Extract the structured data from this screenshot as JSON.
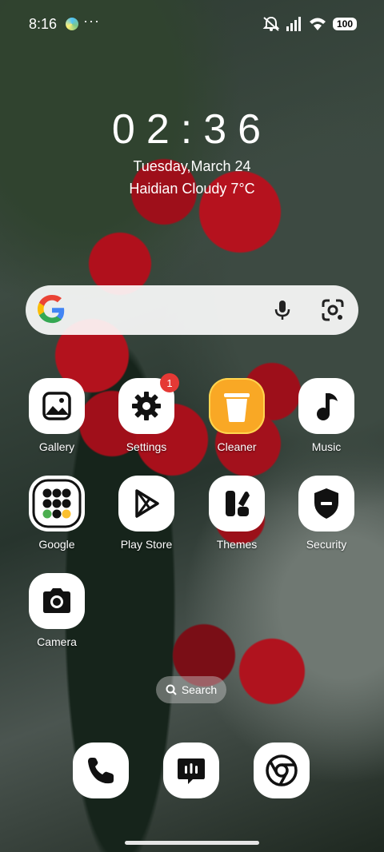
{
  "status_bar": {
    "time": "8:16",
    "more": "···",
    "battery": "100",
    "icons": [
      "app-notification-icon",
      "mute-icon",
      "signal-icon",
      "wifi-icon",
      "battery-icon"
    ]
  },
  "clock": {
    "time": "02:36",
    "date": "Tuesday,March 24",
    "weather": "Haidian Cloudy 7°C"
  },
  "search_widget": {
    "icons": [
      "google-logo-icon",
      "mic-icon",
      "google-lens-icon"
    ]
  },
  "apps": [
    {
      "label": "Gallery",
      "icon": "gallery-icon"
    },
    {
      "label": "Settings",
      "icon": "gear-icon",
      "badge": "1"
    },
    {
      "label": "Cleaner",
      "icon": "trash-icon"
    },
    {
      "label": "Music",
      "icon": "music-note-icon"
    },
    {
      "label": "Google",
      "icon": "google-folder-icon"
    },
    {
      "label": "Play Store",
      "icon": "play-store-icon"
    },
    {
      "label": "Themes",
      "icon": "themes-icon"
    },
    {
      "label": "Security",
      "icon": "shield-icon"
    },
    {
      "label": "Camera",
      "icon": "camera-icon"
    }
  ],
  "search_pill": {
    "label": "Search"
  },
  "dock": [
    {
      "icon": "phone-icon"
    },
    {
      "icon": "messages-icon"
    },
    {
      "icon": "chrome-icon"
    }
  ],
  "colors": {
    "cleaner_accent": "#f9a825",
    "badge": "#e53935"
  }
}
